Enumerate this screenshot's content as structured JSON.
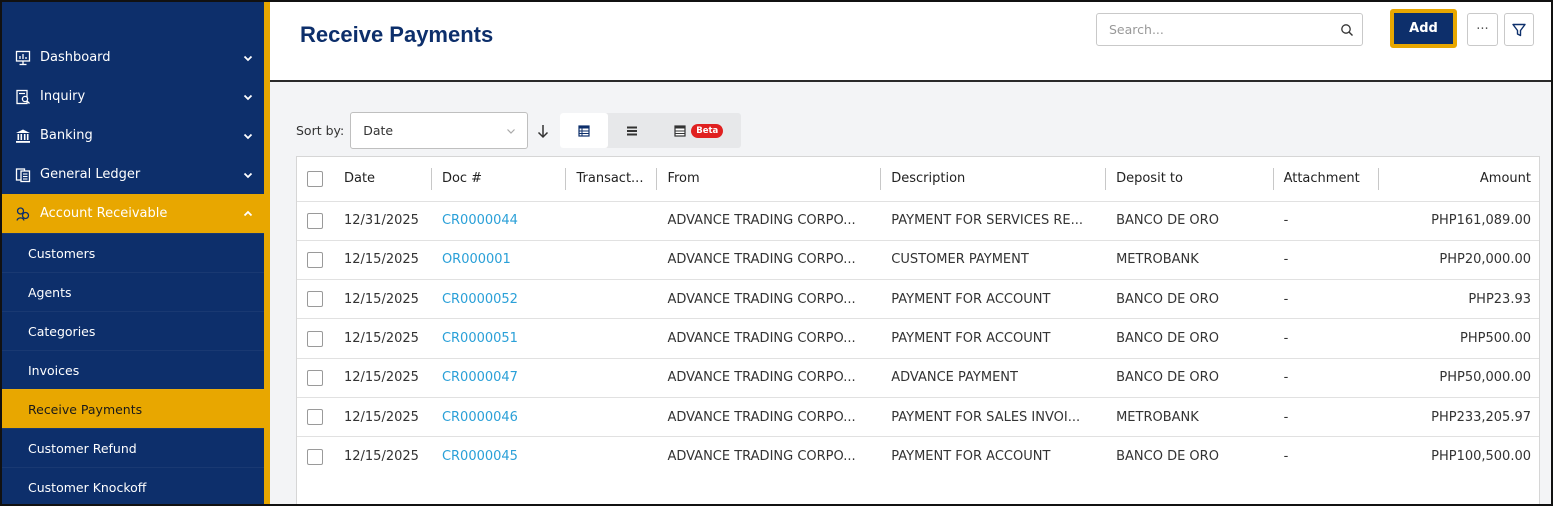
{
  "sidebar": {
    "items": [
      {
        "label": "Dashboard",
        "icon": "monitor-chart-icon"
      },
      {
        "label": "Inquiry",
        "icon": "document-search-icon"
      },
      {
        "label": "Banking",
        "icon": "bank-icon"
      },
      {
        "label": "General Ledger",
        "icon": "ledger-icon"
      },
      {
        "label": "Account Receivable",
        "icon": "receivable-icon"
      }
    ],
    "sub_items": [
      {
        "label": "Customers"
      },
      {
        "label": "Agents"
      },
      {
        "label": "Categories"
      },
      {
        "label": "Invoices"
      },
      {
        "label": "Receive Payments"
      },
      {
        "label": "Customer Refund"
      },
      {
        "label": "Customer Knockoff"
      }
    ]
  },
  "header": {
    "title": "Receive Payments",
    "search_placeholder": "Search...",
    "add_label": "Add",
    "more_label": "···"
  },
  "toolbar": {
    "sort_label": "Sort by:",
    "sort_value": "Date",
    "beta_label": "Beta"
  },
  "table": {
    "columns": [
      "Date",
      "Doc #",
      "Transact...",
      "From",
      "Description",
      "Deposit to",
      "Attachment",
      "Amount"
    ],
    "rows": [
      {
        "date": "12/31/2025",
        "doc": "CR0000044",
        "transaction": "",
        "from": "ADVANCE TRADING CORPO...",
        "description": "PAYMENT FOR SERVICES RE...",
        "deposit_to": "BANCO DE ORO",
        "attachment": "-",
        "amount": "PHP161,089.00"
      },
      {
        "date": "12/15/2025",
        "doc": "OR000001",
        "transaction": "",
        "from": "ADVANCE TRADING CORPO...",
        "description": "CUSTOMER PAYMENT",
        "deposit_to": "METROBANK",
        "attachment": "-",
        "amount": "PHP20,000.00"
      },
      {
        "date": "12/15/2025",
        "doc": "CR0000052",
        "transaction": "",
        "from": "ADVANCE TRADING CORPO...",
        "description": "PAYMENT FOR ACCOUNT",
        "deposit_to": "BANCO DE ORO",
        "attachment": "-",
        "amount": "PHP23.93"
      },
      {
        "date": "12/15/2025",
        "doc": "CR0000051",
        "transaction": "",
        "from": "ADVANCE TRADING CORPO...",
        "description": "PAYMENT FOR ACCOUNT",
        "deposit_to": "BANCO DE ORO",
        "attachment": "-",
        "amount": "PHP500.00"
      },
      {
        "date": "12/15/2025",
        "doc": "CR0000047",
        "transaction": "",
        "from": "ADVANCE TRADING CORPO...",
        "description": "ADVANCE PAYMENT",
        "deposit_to": "BANCO DE ORO",
        "attachment": "-",
        "amount": "PHP50,000.00"
      },
      {
        "date": "12/15/2025",
        "doc": "CR0000046",
        "transaction": "",
        "from": "ADVANCE TRADING CORPO...",
        "description": "PAYMENT FOR SALES INVOI...",
        "deposit_to": "METROBANK",
        "attachment": "-",
        "amount": "PHP233,205.97"
      },
      {
        "date": "12/15/2025",
        "doc": "CR0000045",
        "transaction": "",
        "from": "ADVANCE TRADING CORPO...",
        "description": "PAYMENT FOR ACCOUNT",
        "deposit_to": "BANCO DE ORO",
        "attachment": "-",
        "amount": "PHP100,500.00"
      }
    ]
  },
  "colors": {
    "sidebar_bg": "#0d2f6b",
    "accent": "#e8a700",
    "link": "#2aa0d8",
    "beta_badge": "#e02020"
  }
}
